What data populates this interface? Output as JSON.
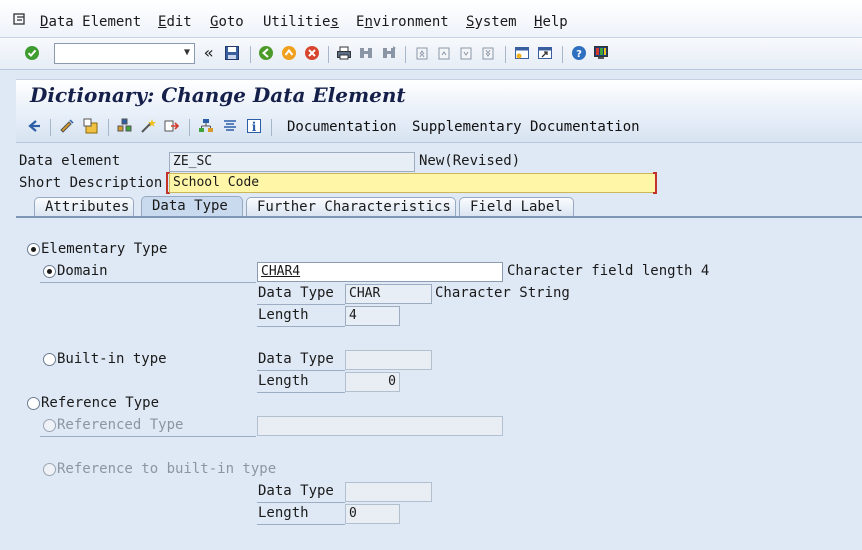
{
  "menu": {
    "items": [
      {
        "label": "Data Element",
        "mnemonic_index": 0
      },
      {
        "label": "Edit",
        "mnemonic_index": 0
      },
      {
        "label": "Goto",
        "mnemonic_index": 0
      },
      {
        "label": "Utilities",
        "mnemonic_index": 8
      },
      {
        "label": "Environment",
        "mnemonic_index": 1
      },
      {
        "label": "System",
        "mnemonic_index": 0
      },
      {
        "label": "Help",
        "mnemonic_index": 0
      }
    ]
  },
  "toolbar": {
    "command_field_value": "",
    "icons": [
      "enter-icon",
      "back-arrows-icon",
      "save-icon",
      "back-icon",
      "exit-icon",
      "cancel-icon",
      "print-icon",
      "find-icon",
      "find-next-icon",
      "first-page-icon",
      "prev-page-icon",
      "next-page-icon",
      "last-page-icon",
      "create-session-icon",
      "shortcut-icon",
      "help-icon",
      "customize-layout-icon"
    ]
  },
  "title": "Dictionary: Change Data Element",
  "app_toolbar": {
    "documentation": "Documentation",
    "supplementary_documentation": "Supplementary Documentation"
  },
  "header": {
    "data_element_label": "Data element",
    "data_element_value": "ZE_SC",
    "status": "New(Revised)",
    "short_description_label": "Short Description",
    "short_description_value": "School Code"
  },
  "tabs": [
    {
      "label": "Attributes",
      "active": false
    },
    {
      "label": "Data Type",
      "active": true
    },
    {
      "label": "Further Characteristics",
      "active": false
    },
    {
      "label": "Field Label",
      "active": false
    }
  ],
  "data_type": {
    "elementary_type_label": "Elementary Type",
    "elementary_type_selected": true,
    "domain_label": "Domain",
    "domain_selected": true,
    "domain_value": "CHAR4",
    "domain_description": "Character field length 4",
    "domain_data_type_label": "Data Type",
    "domain_data_type_value": "CHAR",
    "domain_data_type_description": "Character String",
    "domain_length_label": "Length",
    "domain_length_value": "4",
    "builtin_type_label": "Built-in type",
    "builtin_data_type_label": "Data Type",
    "builtin_data_type_value": "",
    "builtin_length_label": "Length",
    "builtin_length_value": "0",
    "reference_type_label": "Reference Type",
    "referenced_type_label": "Referenced Type",
    "referenced_type_value": "",
    "reference_builtin_label": "Reference to built-in type",
    "ref_data_type_label": "Data Type",
    "ref_data_type_value": "",
    "ref_length_label": "Length",
    "ref_length_value": "0"
  }
}
